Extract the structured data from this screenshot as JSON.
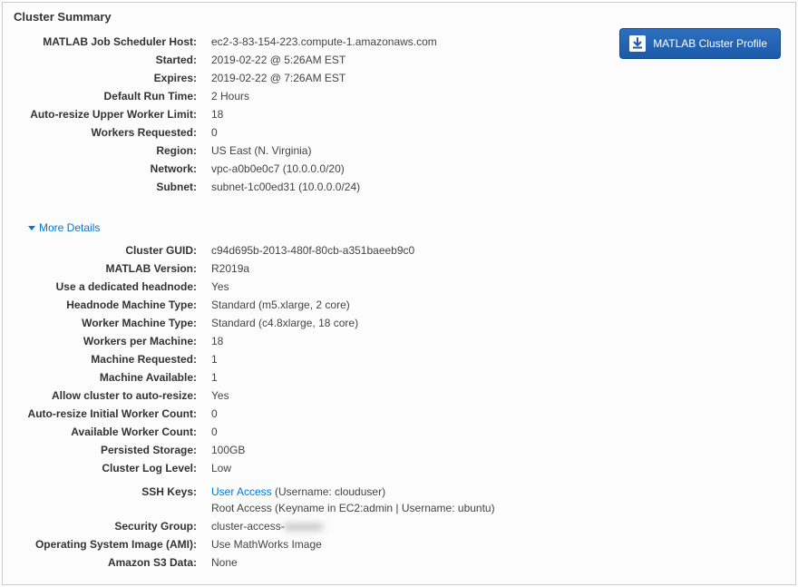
{
  "panel_title": "Cluster Summary",
  "profile_button_label": "MATLAB Cluster Profile",
  "more_details_label": "More Details",
  "summary": {
    "mjs_host": {
      "label": "MATLAB Job Scheduler Host:",
      "value": "ec2-3-83-154-223.compute-1.amazonaws.com"
    },
    "started": {
      "label": "Started:",
      "value": "2019-02-22 @ 5:26AM EST"
    },
    "expires": {
      "label": "Expires:",
      "value": "2019-02-22 @ 7:26AM EST"
    },
    "default_run_time": {
      "label": "Default Run Time:",
      "value": "2 Hours"
    },
    "autoresize_upper": {
      "label": "Auto-resize Upper Worker Limit:",
      "value": "18"
    },
    "workers_requested": {
      "label": "Workers Requested:",
      "value": "0"
    },
    "region": {
      "label": "Region:",
      "value": "US East (N. Virginia)"
    },
    "network": {
      "label": "Network:",
      "value": "vpc-a0b0e0c7 (10.0.0.0/20)"
    },
    "subnet": {
      "label": "Subnet:",
      "value": "subnet-1c00ed31 (10.0.0.0/24)"
    }
  },
  "details": {
    "cluster_guid": {
      "label": "Cluster GUID:",
      "value": "c94d695b-2013-480f-80cb-a351baeeb9c0"
    },
    "matlab_version": {
      "label": "MATLAB Version:",
      "value": "R2019a"
    },
    "dedicated_headnode": {
      "label": "Use a dedicated headnode:",
      "value": "Yes"
    },
    "headnode_type": {
      "label": "Headnode Machine Type:",
      "value": "Standard (m5.xlarge, 2 core)"
    },
    "worker_type": {
      "label": "Worker Machine Type:",
      "value": "Standard (c4.8xlarge, 18 core)"
    },
    "workers_per_machine": {
      "label": "Workers per Machine:",
      "value": "18"
    },
    "machine_requested": {
      "label": "Machine Requested:",
      "value": "1"
    },
    "machine_available": {
      "label": "Machine Available:",
      "value": "1"
    },
    "allow_autoresize": {
      "label": "Allow cluster to auto-resize:",
      "value": "Yes"
    },
    "autoresize_initial": {
      "label": "Auto-resize Initial Worker Count:",
      "value": "0"
    },
    "available_worker_count": {
      "label": "Available Worker Count:",
      "value": "0"
    },
    "persisted_storage": {
      "label": "Persisted Storage:",
      "value": "100GB"
    },
    "cluster_log_level": {
      "label": "Cluster Log Level:",
      "value": "Low"
    },
    "ssh_keys": {
      "label": "SSH Keys:",
      "user_access_link": "User Access",
      "user_access_suffix": " (Username: clouduser)",
      "root_access": "Root Access (Keyname in EC2:admin | Username: ubuntu)"
    },
    "security_group": {
      "label": "Security Group:",
      "prefix": "cluster-access-",
      "redacted": "xxxxxxx"
    },
    "ami": {
      "label": "Operating System Image (AMI):",
      "value": "Use MathWorks Image"
    },
    "s3_data": {
      "label": "Amazon S3 Data:",
      "value": "None"
    }
  }
}
